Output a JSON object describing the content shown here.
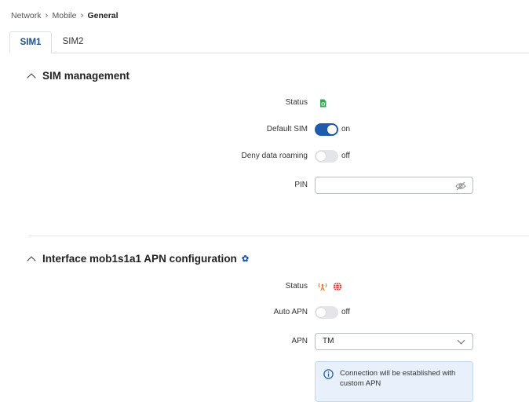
{
  "breadcrumb": {
    "items": [
      "Network",
      "Mobile",
      "General"
    ]
  },
  "tabs": [
    {
      "label": "SIM1",
      "active": true
    },
    {
      "label": "SIM2",
      "active": false
    }
  ],
  "sim_management": {
    "title": "SIM management",
    "status_label": "Status",
    "status_icon": "sim-card-icon",
    "default_sim": {
      "label": "Default SIM",
      "state": "on"
    },
    "deny_roaming": {
      "label": "Deny data roaming",
      "state": "off"
    },
    "pin": {
      "label": "PIN",
      "value": "",
      "placeholder": ""
    }
  },
  "apn_config": {
    "title": "Interface mob1s1a1 APN configuration",
    "status_label": "Status",
    "status_icons": [
      "signal-tower-icon",
      "globe-icon"
    ],
    "auto_apn": {
      "label": "Auto APN",
      "state": "off"
    },
    "apn": {
      "label": "APN",
      "value": "TM"
    },
    "info_text": "Connection will be established with custom APN"
  },
  "colors": {
    "accent": "#1c5bad",
    "status_green": "#3aa655",
    "status_orange": "#e8711c",
    "status_red": "#e0372f",
    "info_bg": "#e8f1fb"
  }
}
